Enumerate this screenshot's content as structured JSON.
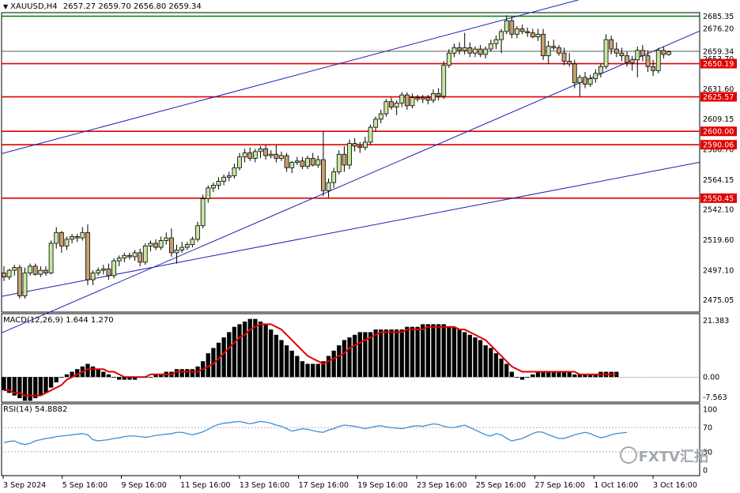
{
  "header": {
    "symbol_label": "XAUUSD,H4",
    "ohlc_values": "2657.27 2659.70 2656.80 2659.34"
  },
  "macd_panel": {
    "label": "MACD(12,26,9) 1.644 1.270"
  },
  "rsi_panel": {
    "label": "RSI(14) 54.8882"
  },
  "watermark": {
    "text": "FXTV汇拓"
  },
  "colors": {
    "candle_up": "#c8e6a0",
    "candle_down": "#c8a070",
    "wick": "#000000",
    "level_line": "#e00000",
    "top_line": "#008000",
    "trend_line": "#1f1fb4",
    "price_line": "#404040",
    "macd_signal": "#e00000",
    "rsi_line": "#3d8fd6"
  },
  "chart_data": [
    {
      "type": "candlestick",
      "title": "",
      "price_axis_ticks": [
        2676.2,
        2653.7,
        2631.6,
        2609.15,
        2586.7,
        2564.15,
        2542.1,
        2519.6,
        2497.1,
        2475.05
      ],
      "ylim": [
        2466,
        2688
      ],
      "horizontal_levels": [
        2650.19,
        2625.57,
        2600.0,
        2590.06,
        2550.45
      ],
      "top_level": 2685.35,
      "last_price": 2659.34,
      "x_tick_labels": [
        "3 Sep 2024",
        "5 Sep 16:00",
        "9 Sep 16:00",
        "11 Sep 16:00",
        "13 Sep 16:00",
        "17 Sep 16:00",
        "19 Sep 16:00",
        "23 Sep 16:00",
        "25 Sep 16:00",
        "27 Sep 16:00",
        "1 Oct 16:00",
        "3 Oct 16:00"
      ],
      "candles": [
        {
          "o": 2495,
          "h": 2500,
          "l": 2489,
          "c": 2492
        },
        {
          "o": 2492,
          "h": 2498,
          "l": 2490,
          "c": 2497
        },
        {
          "o": 2497,
          "h": 2501,
          "l": 2493,
          "c": 2499
        },
        {
          "o": 2499,
          "h": 2501,
          "l": 2476,
          "c": 2478
        },
        {
          "o": 2478,
          "h": 2499,
          "l": 2476,
          "c": 2495
        },
        {
          "o": 2495,
          "h": 2502,
          "l": 2493,
          "c": 2500
        },
        {
          "o": 2500,
          "h": 2502,
          "l": 2493,
          "c": 2494
        },
        {
          "o": 2494,
          "h": 2500,
          "l": 2492,
          "c": 2497
        },
        {
          "o": 2497,
          "h": 2500,
          "l": 2493,
          "c": 2495
        },
        {
          "o": 2495,
          "h": 2519,
          "l": 2494,
          "c": 2517
        },
        {
          "o": 2517,
          "h": 2529,
          "l": 2513,
          "c": 2525
        },
        {
          "o": 2525,
          "h": 2526,
          "l": 2510,
          "c": 2515
        },
        {
          "o": 2515,
          "h": 2522,
          "l": 2512,
          "c": 2520
        },
        {
          "o": 2520,
          "h": 2524,
          "l": 2517,
          "c": 2522
        },
        {
          "o": 2522,
          "h": 2524,
          "l": 2518,
          "c": 2521
        },
        {
          "o": 2521,
          "h": 2529,
          "l": 2519,
          "c": 2525
        },
        {
          "o": 2525,
          "h": 2531,
          "l": 2486,
          "c": 2490
        },
        {
          "o": 2490,
          "h": 2497,
          "l": 2486,
          "c": 2495
        },
        {
          "o": 2495,
          "h": 2499,
          "l": 2493,
          "c": 2497
        },
        {
          "o": 2497,
          "h": 2501,
          "l": 2494,
          "c": 2498
        },
        {
          "o": 2498,
          "h": 2502,
          "l": 2490,
          "c": 2493
        },
        {
          "o": 2493,
          "h": 2506,
          "l": 2491,
          "c": 2504
        },
        {
          "o": 2504,
          "h": 2508,
          "l": 2500,
          "c": 2506
        },
        {
          "o": 2506,
          "h": 2510,
          "l": 2503,
          "c": 2508
        },
        {
          "o": 2508,
          "h": 2510,
          "l": 2505,
          "c": 2507
        },
        {
          "o": 2507,
          "h": 2512,
          "l": 2504,
          "c": 2510
        },
        {
          "o": 2510,
          "h": 2513,
          "l": 2500,
          "c": 2503
        },
        {
          "o": 2503,
          "h": 2517,
          "l": 2501,
          "c": 2515
        },
        {
          "o": 2515,
          "h": 2519,
          "l": 2511,
          "c": 2517
        },
        {
          "o": 2517,
          "h": 2520,
          "l": 2512,
          "c": 2514
        },
        {
          "o": 2514,
          "h": 2522,
          "l": 2512,
          "c": 2519
        },
        {
          "o": 2519,
          "h": 2525,
          "l": 2516,
          "c": 2521
        },
        {
          "o": 2521,
          "h": 2528,
          "l": 2507,
          "c": 2510
        },
        {
          "o": 2510,
          "h": 2516,
          "l": 2502,
          "c": 2512
        },
        {
          "o": 2512,
          "h": 2518,
          "l": 2510,
          "c": 2514
        },
        {
          "o": 2514,
          "h": 2518,
          "l": 2512,
          "c": 2516
        },
        {
          "o": 2516,
          "h": 2522,
          "l": 2514,
          "c": 2520
        },
        {
          "o": 2520,
          "h": 2533,
          "l": 2518,
          "c": 2530
        },
        {
          "o": 2530,
          "h": 2553,
          "l": 2528,
          "c": 2550
        },
        {
          "o": 2550,
          "h": 2560,
          "l": 2547,
          "c": 2558
        },
        {
          "o": 2558,
          "h": 2562,
          "l": 2555,
          "c": 2560
        },
        {
          "o": 2560,
          "h": 2566,
          "l": 2557,
          "c": 2563
        },
        {
          "o": 2563,
          "h": 2568,
          "l": 2560,
          "c": 2566
        },
        {
          "o": 2566,
          "h": 2570,
          "l": 2563,
          "c": 2567
        },
        {
          "o": 2567,
          "h": 2576,
          "l": 2565,
          "c": 2573
        },
        {
          "o": 2573,
          "h": 2584,
          "l": 2571,
          "c": 2581
        },
        {
          "o": 2581,
          "h": 2587,
          "l": 2577,
          "c": 2584
        },
        {
          "o": 2584,
          "h": 2588,
          "l": 2578,
          "c": 2580
        },
        {
          "o": 2580,
          "h": 2587,
          "l": 2577,
          "c": 2585
        },
        {
          "o": 2585,
          "h": 2589,
          "l": 2580,
          "c": 2587
        },
        {
          "o": 2587,
          "h": 2590,
          "l": 2579,
          "c": 2582
        },
        {
          "o": 2582,
          "h": 2586,
          "l": 2580,
          "c": 2583
        },
        {
          "o": 2583,
          "h": 2590,
          "l": 2577,
          "c": 2580
        },
        {
          "o": 2580,
          "h": 2585,
          "l": 2578,
          "c": 2582
        },
        {
          "o": 2582,
          "h": 2584,
          "l": 2570,
          "c": 2573
        },
        {
          "o": 2573,
          "h": 2578,
          "l": 2569,
          "c": 2577
        },
        {
          "o": 2577,
          "h": 2581,
          "l": 2575,
          "c": 2578
        },
        {
          "o": 2578,
          "h": 2581,
          "l": 2572,
          "c": 2574
        },
        {
          "o": 2574,
          "h": 2582,
          "l": 2572,
          "c": 2580
        },
        {
          "o": 2580,
          "h": 2584,
          "l": 2574,
          "c": 2575
        },
        {
          "o": 2575,
          "h": 2582,
          "l": 2573,
          "c": 2579
        },
        {
          "o": 2579,
          "h": 2600,
          "l": 2552,
          "c": 2556
        },
        {
          "o": 2556,
          "h": 2565,
          "l": 2551,
          "c": 2562
        },
        {
          "o": 2562,
          "h": 2573,
          "l": 2558,
          "c": 2570
        },
        {
          "o": 2570,
          "h": 2586,
          "l": 2568,
          "c": 2583
        },
        {
          "o": 2583,
          "h": 2589,
          "l": 2570,
          "c": 2575
        },
        {
          "o": 2575,
          "h": 2594,
          "l": 2572,
          "c": 2591
        },
        {
          "o": 2591,
          "h": 2595,
          "l": 2585,
          "c": 2589
        },
        {
          "o": 2589,
          "h": 2592,
          "l": 2584,
          "c": 2588
        },
        {
          "o": 2588,
          "h": 2596,
          "l": 2586,
          "c": 2592
        },
        {
          "o": 2592,
          "h": 2605,
          "l": 2590,
          "c": 2603
        },
        {
          "o": 2603,
          "h": 2611,
          "l": 2600,
          "c": 2609
        },
        {
          "o": 2609,
          "h": 2616,
          "l": 2606,
          "c": 2613
        },
        {
          "o": 2613,
          "h": 2624,
          "l": 2611,
          "c": 2622
        },
        {
          "o": 2622,
          "h": 2625,
          "l": 2616,
          "c": 2618
        },
        {
          "o": 2618,
          "h": 2623,
          "l": 2612,
          "c": 2621
        },
        {
          "o": 2621,
          "h": 2629,
          "l": 2618,
          "c": 2627
        },
        {
          "o": 2627,
          "h": 2629,
          "l": 2616,
          "c": 2619
        },
        {
          "o": 2619,
          "h": 2628,
          "l": 2617,
          "c": 2625
        },
        {
          "o": 2625,
          "h": 2627,
          "l": 2622,
          "c": 2624
        },
        {
          "o": 2624,
          "h": 2627,
          "l": 2621,
          "c": 2625
        },
        {
          "o": 2625,
          "h": 2627,
          "l": 2620,
          "c": 2623
        },
        {
          "o": 2623,
          "h": 2631,
          "l": 2621,
          "c": 2628
        },
        {
          "o": 2628,
          "h": 2632,
          "l": 2623,
          "c": 2626
        },
        {
          "o": 2626,
          "h": 2652,
          "l": 2624,
          "c": 2649
        },
        {
          "o": 2649,
          "h": 2661,
          "l": 2647,
          "c": 2658
        },
        {
          "o": 2658,
          "h": 2665,
          "l": 2655,
          "c": 2662
        },
        {
          "o": 2662,
          "h": 2666,
          "l": 2657,
          "c": 2660
        },
        {
          "o": 2660,
          "h": 2673,
          "l": 2657,
          "c": 2662
        },
        {
          "o": 2662,
          "h": 2666,
          "l": 2655,
          "c": 2658
        },
        {
          "o": 2658,
          "h": 2663,
          "l": 2655,
          "c": 2661
        },
        {
          "o": 2661,
          "h": 2664,
          "l": 2655,
          "c": 2657
        },
        {
          "o": 2657,
          "h": 2663,
          "l": 2654,
          "c": 2661
        },
        {
          "o": 2661,
          "h": 2668,
          "l": 2659,
          "c": 2665
        },
        {
          "o": 2665,
          "h": 2671,
          "l": 2661,
          "c": 2668
        },
        {
          "o": 2668,
          "h": 2676,
          "l": 2658,
          "c": 2674
        },
        {
          "o": 2674,
          "h": 2686,
          "l": 2672,
          "c": 2682
        },
        {
          "o": 2682,
          "h": 2685,
          "l": 2669,
          "c": 2672
        },
        {
          "o": 2672,
          "h": 2678,
          "l": 2669,
          "c": 2676
        },
        {
          "o": 2676,
          "h": 2679,
          "l": 2672,
          "c": 2674
        },
        {
          "o": 2674,
          "h": 2677,
          "l": 2670,
          "c": 2673
        },
        {
          "o": 2673,
          "h": 2676,
          "l": 2669,
          "c": 2670
        },
        {
          "o": 2670,
          "h": 2676,
          "l": 2667,
          "c": 2672
        },
        {
          "o": 2672,
          "h": 2676,
          "l": 2653,
          "c": 2656
        },
        {
          "o": 2656,
          "h": 2667,
          "l": 2650,
          "c": 2663
        },
        {
          "o": 2663,
          "h": 2668,
          "l": 2660,
          "c": 2662
        },
        {
          "o": 2662,
          "h": 2664,
          "l": 2656,
          "c": 2658
        },
        {
          "o": 2658,
          "h": 2662,
          "l": 2649,
          "c": 2652
        },
        {
          "o": 2652,
          "h": 2658,
          "l": 2648,
          "c": 2650
        },
        {
          "o": 2650,
          "h": 2653,
          "l": 2632,
          "c": 2636
        },
        {
          "o": 2636,
          "h": 2642,
          "l": 2626,
          "c": 2640
        },
        {
          "o": 2640,
          "h": 2644,
          "l": 2632,
          "c": 2635
        },
        {
          "o": 2635,
          "h": 2642,
          "l": 2633,
          "c": 2639
        },
        {
          "o": 2639,
          "h": 2646,
          "l": 2636,
          "c": 2643
        },
        {
          "o": 2643,
          "h": 2650,
          "l": 2640,
          "c": 2648
        },
        {
          "o": 2648,
          "h": 2672,
          "l": 2646,
          "c": 2668
        },
        {
          "o": 2668,
          "h": 2671,
          "l": 2657,
          "c": 2661
        },
        {
          "o": 2661,
          "h": 2666,
          "l": 2655,
          "c": 2658
        },
        {
          "o": 2658,
          "h": 2662,
          "l": 2652,
          "c": 2656
        },
        {
          "o": 2656,
          "h": 2659,
          "l": 2648,
          "c": 2651
        },
        {
          "o": 2651,
          "h": 2656,
          "l": 2645,
          "c": 2653
        },
        {
          "o": 2653,
          "h": 2663,
          "l": 2640,
          "c": 2660
        },
        {
          "o": 2660,
          "h": 2664,
          "l": 2652,
          "c": 2656
        },
        {
          "o": 2656,
          "h": 2660,
          "l": 2644,
          "c": 2648
        },
        {
          "o": 2648,
          "h": 2653,
          "l": 2641,
          "c": 2645
        },
        {
          "o": 2645,
          "h": 2662,
          "l": 2643,
          "c": 2660
        },
        {
          "o": 2660,
          "h": 2663,
          "l": 2654,
          "c": 2657
        },
        {
          "o": 2657,
          "h": 2660,
          "l": 2656,
          "c": 2659
        }
      ]
    },
    {
      "type": "bar",
      "title": "MACD(12,26,9)",
      "axis_ticks": [
        21.383,
        0.0,
        -7.563
      ],
      "ylim": [
        -9.5,
        24
      ],
      "histogram": [
        -5,
        -6,
        -7,
        -8,
        -9,
        -9,
        -8,
        -7,
        -6,
        -4,
        -2,
        0,
        1,
        2,
        3,
        4,
        5,
        4,
        3,
        2,
        1,
        0,
        -1,
        -1,
        -1,
        -1,
        0,
        0,
        0,
        1,
        1,
        2,
        2,
        3,
        3,
        3,
        3,
        4,
        6,
        9,
        11,
        13,
        15,
        17,
        19,
        20,
        21,
        22,
        22,
        21,
        20,
        18,
        16,
        14,
        12,
        10,
        8,
        6,
        5,
        5,
        5,
        6,
        8,
        10,
        12,
        14,
        15,
        16,
        17,
        17,
        17,
        18,
        18,
        18,
        18,
        18,
        18,
        19,
        19,
        19,
        20,
        20,
        20,
        20,
        20,
        19,
        19,
        18,
        17,
        16,
        15,
        14,
        12,
        11,
        9,
        7,
        5,
        2,
        0,
        -1,
        0,
        1,
        2,
        2,
        2,
        2,
        2,
        2,
        2,
        1,
        1,
        1,
        1,
        1,
        2,
        2,
        2,
        2
      ],
      "signal": [
        -5,
        -5,
        -6,
        -6,
        -7,
        -7,
        -7,
        -7,
        -6,
        -5,
        -4,
        -3,
        -1,
        0,
        1,
        2,
        3,
        3,
        3,
        3,
        2,
        2,
        1,
        0,
        0,
        0,
        0,
        0,
        1,
        1,
        1,
        1,
        1,
        2,
        2,
        2,
        2,
        2,
        3,
        4,
        5,
        7,
        9,
        11,
        13,
        15,
        16,
        18,
        19,
        20,
        20,
        20,
        19,
        18,
        16,
        14,
        12,
        10,
        8,
        7,
        6,
        5,
        6,
        7,
        8,
        9,
        11,
        12,
        13,
        14,
        15,
        16,
        17,
        17,
        17,
        17,
        17,
        18,
        18,
        18,
        18,
        19,
        19,
        19,
        19,
        19,
        19,
        18,
        18,
        17,
        16,
        15,
        14,
        12,
        10,
        8,
        6,
        4,
        3,
        2,
        2,
        2,
        2,
        2,
        2,
        2,
        2,
        2,
        2,
        2,
        1,
        1,
        1,
        1,
        1,
        1,
        1,
        1
      ]
    },
    {
      "type": "line",
      "title": "RSI(14)",
      "axis_ticks": [
        100,
        70,
        30,
        0
      ],
      "ylim": [
        0,
        100
      ],
      "series": [
        {
          "values": [
            45,
            47,
            48,
            44,
            42,
            44,
            48,
            50,
            52,
            53,
            55,
            56,
            57,
            58,
            59,
            60,
            58,
            50,
            48,
            49,
            50,
            52,
            53,
            55,
            56,
            56,
            55,
            54,
            55,
            57,
            58,
            59,
            60,
            62,
            62,
            60,
            58,
            60,
            63,
            67,
            72,
            75,
            77,
            78,
            79,
            80,
            78,
            76,
            78,
            80,
            79,
            77,
            74,
            72,
            68,
            64,
            66,
            68,
            67,
            65,
            63,
            62,
            66,
            68,
            72,
            74,
            73,
            72,
            70,
            68,
            70,
            72,
            73,
            71,
            70,
            69,
            68,
            70,
            72,
            73,
            72,
            74,
            76,
            75,
            72,
            70,
            70,
            72,
            74,
            70,
            66,
            62,
            58,
            56,
            60,
            58,
            52,
            48,
            50,
            52,
            56,
            60,
            63,
            62,
            58,
            55,
            52,
            52,
            55,
            58,
            60,
            62,
            60,
            56,
            53,
            55,
            58,
            60,
            61,
            62
          ]
        }
      ]
    }
  ]
}
